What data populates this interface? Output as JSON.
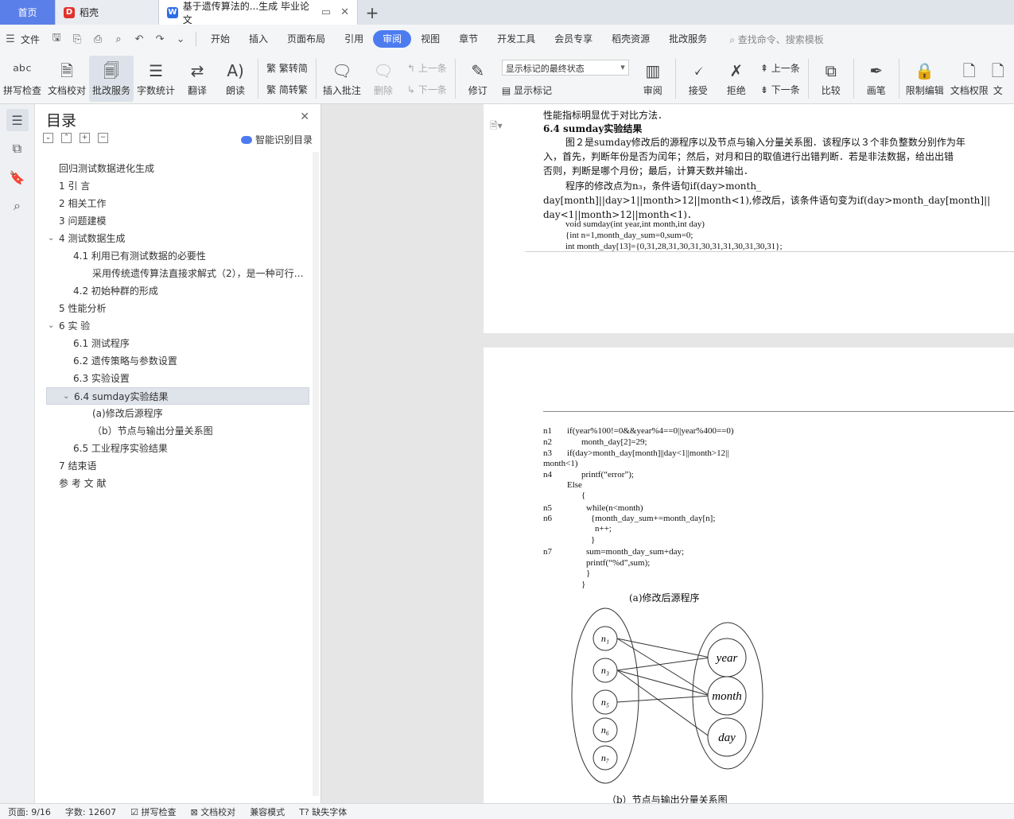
{
  "tabs": {
    "home": "首页",
    "daoke": "稻壳",
    "doc": "基于遗传算法的...生成 毕业论文"
  },
  "menubar": {
    "file": "文件",
    "items": [
      "开始",
      "插入",
      "页面布局",
      "引用",
      "审阅",
      "视图",
      "章节",
      "开发工具",
      "会员专享",
      "稻壳资源",
      "批改服务"
    ],
    "active": "审阅",
    "search": "查找命令、搜索模板"
  },
  "toolbar": {
    "spell": "拼写检查",
    "proof": "文档校对",
    "correct": "批改服务",
    "wordcount": "字数统计",
    "translate": "翻译",
    "read": "朗读",
    "trad2simp": "繁转简",
    "simp2trad": "简转繁",
    "insert_comment": "插入批注",
    "delete": "删除",
    "prev": "上一条",
    "next": "下一条",
    "markup_select": "显示标记的最终状态",
    "revise": "修订",
    "show_markup": "显示标记",
    "review": "审阅",
    "accept": "接受",
    "reject": "拒绝",
    "prev2": "上一条",
    "next2": "下一条",
    "compare": "比较",
    "pen": "画笔",
    "restrict": "限制编辑",
    "permission": "文档权限",
    "more": "文"
  },
  "toc": {
    "title": "目录",
    "smart": "智能识别目录",
    "items": [
      {
        "text": "回归测试数据进化生成",
        "level": 0
      },
      {
        "text": "1   引      言",
        "level": 0
      },
      {
        "text": "2   相关工作",
        "level": 0
      },
      {
        "text": "3    问题建模",
        "level": 0
      },
      {
        "text": "4    测试数据生成",
        "level": 0,
        "arrow": true
      },
      {
        "text": "4.1     利用已有测试数据的必要性",
        "level": 1
      },
      {
        "text": "采用传统遗传算法直接求解式（2），是一种可行的方法……",
        "level": 2
      },
      {
        "text": "4.2    初始种群的形成",
        "level": 1
      },
      {
        "text": "5    性能分析",
        "level": 0
      },
      {
        "text": "6   实    验",
        "level": 0,
        "arrow": true
      },
      {
        "text": "6.1    测试程序",
        "level": 1
      },
      {
        "text": "6.2    遗传策略与参数设置",
        "level": 1
      },
      {
        "text": "6.3    实验设置",
        "level": 1
      },
      {
        "text": "6.4    sumday实验结果",
        "level": 1,
        "arrow": true,
        "selected": true
      },
      {
        "text": "(a)修改后源程序",
        "level": 2
      },
      {
        "text": "（b）节点与输出分量关系图",
        "level": 2
      },
      {
        "text": "6.5    工业程序实验结果",
        "level": 1
      },
      {
        "text": "7   结束语",
        "level": 0
      },
      {
        "text": "参 考 文 献",
        "level": 0
      }
    ]
  },
  "page1": {
    "lines": [
      "性能指标明显优于对比方法．",
      "6.4   sumday实验结果",
      "图２是sumday修改后的源程序以及节点与输入分量关系图．该程序以３个非负整数分别作为年",
      "入，首先，判断年份是否为闰年；然后，对月和日的取值进行出错判断．若是非法数据，给出出错",
      "否则，判断是哪个月份；最后，计算天数并输出．",
      "程序的修改点为n₃，条件语句if(day>month_",
      "day[month]||day>1||month>12||month<1),修改后，该条件语句变为if(day>month_day[month]||",
      "day<1||month>12||month<1)．",
      "void  sumday(int  year,int  month,int  day)",
      "{int  n=1,month_day_sum=0,sum=0;",
      "int  month_day[13]={0,31,28,31,30,31,30,31,31,30,31,30,31};"
    ]
  },
  "page2": {
    "code": [
      [
        "n1",
        "if(year%100!=0&&year%4==0||year%400==0)"
      ],
      [
        "n2",
        "month_day[2]=29;"
      ],
      [
        "n3",
        "if(day>month_day[month]||day<1||month>12||"
      ],
      [
        "",
        "month<1)"
      ],
      [
        "n4",
        "printf(“error”);"
      ],
      [
        "",
        "Else"
      ],
      [
        "",
        "{"
      ],
      [
        "n5",
        "while(n<month)"
      ],
      [
        "n6",
        "{month_day_sum+=month_day[n];"
      ],
      [
        "",
        "n++;"
      ],
      [
        "",
        "}"
      ],
      [
        "n7",
        "sum=month_day_sum+day;"
      ],
      [
        "",
        "printf(“%d”,sum);"
      ],
      [
        "",
        "}"
      ],
      [
        "",
        "}"
      ]
    ],
    "caption_a": "(a)修改后源程序",
    "caption_b": "（b）节点与输出分量关系图",
    "nodes": [
      "n₁",
      "n₃",
      "n₅",
      "n₆",
      "n₇"
    ],
    "outputs": [
      "year",
      "month",
      "day"
    ]
  },
  "status": {
    "page": "页面: 9/16",
    "words": "字数: 12607",
    "spell": "拼写检查",
    "proof": "文档校对",
    "compat": "兼容模式",
    "font": "缺失字体"
  }
}
